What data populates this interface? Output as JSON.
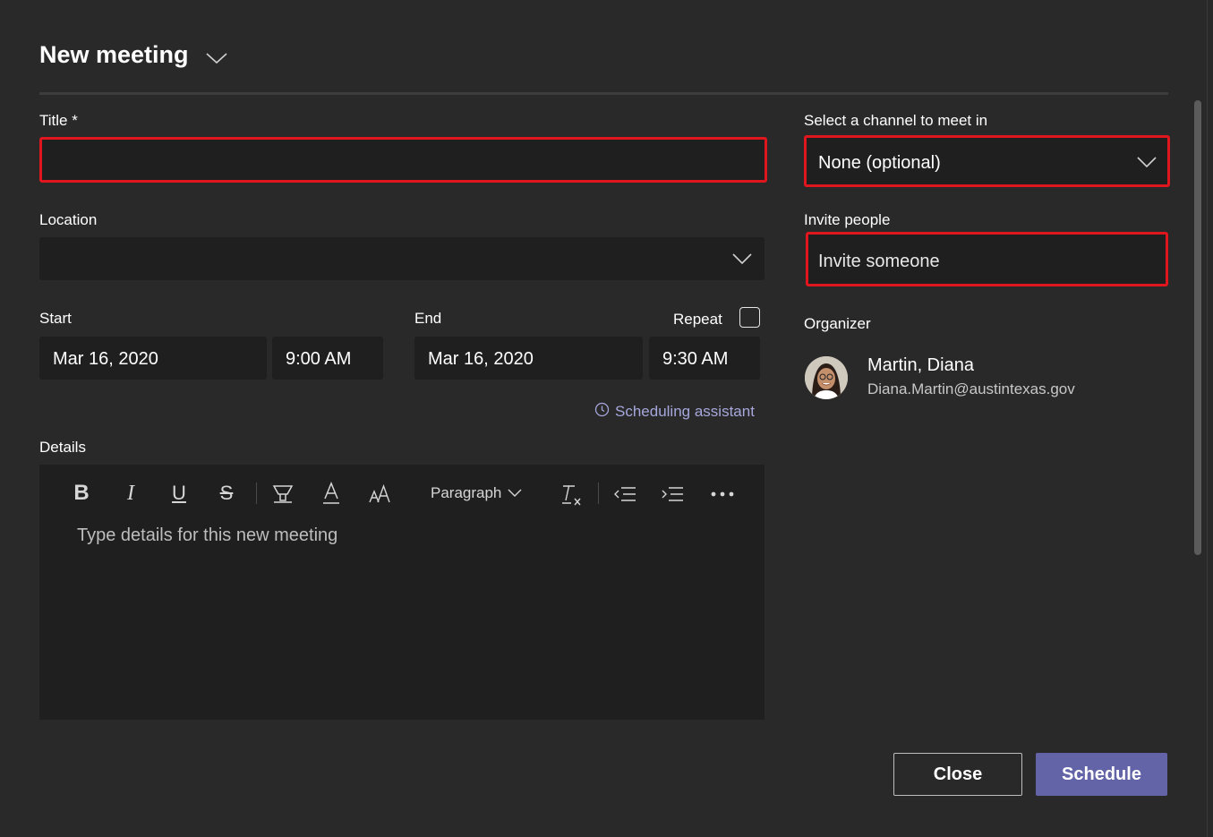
{
  "header": {
    "title": "New meeting"
  },
  "form": {
    "title_label": "Title *",
    "title_value": "",
    "location_label": "Location",
    "location_value": "",
    "start_label": "Start",
    "start_date": "Mar 16, 2020",
    "start_time": "9:00 AM",
    "end_label": "End",
    "end_date": "Mar 16, 2020",
    "end_time": "9:30 AM",
    "repeat_label": "Repeat",
    "scheduling_assistant": "Scheduling assistant",
    "details_label": "Details",
    "details_placeholder": "Type details for this new meeting",
    "paragraph_label": "Paragraph"
  },
  "right": {
    "channel_label": "Select a channel to meet in",
    "channel_value": "None (optional)",
    "invite_label": "Invite people",
    "invite_placeholder": "Invite someone",
    "organizer_label": "Organizer",
    "organizer_name": "Martin, Diana",
    "organizer_email": "Diana.Martin@austintexas.gov"
  },
  "footer": {
    "close_label": "Close",
    "schedule_label": "Schedule"
  },
  "colors": {
    "background": "#292929",
    "field": "#1f1f1f",
    "accent": "#6264a7",
    "highlight": "#e0161e",
    "link": "#a6a7dc"
  }
}
